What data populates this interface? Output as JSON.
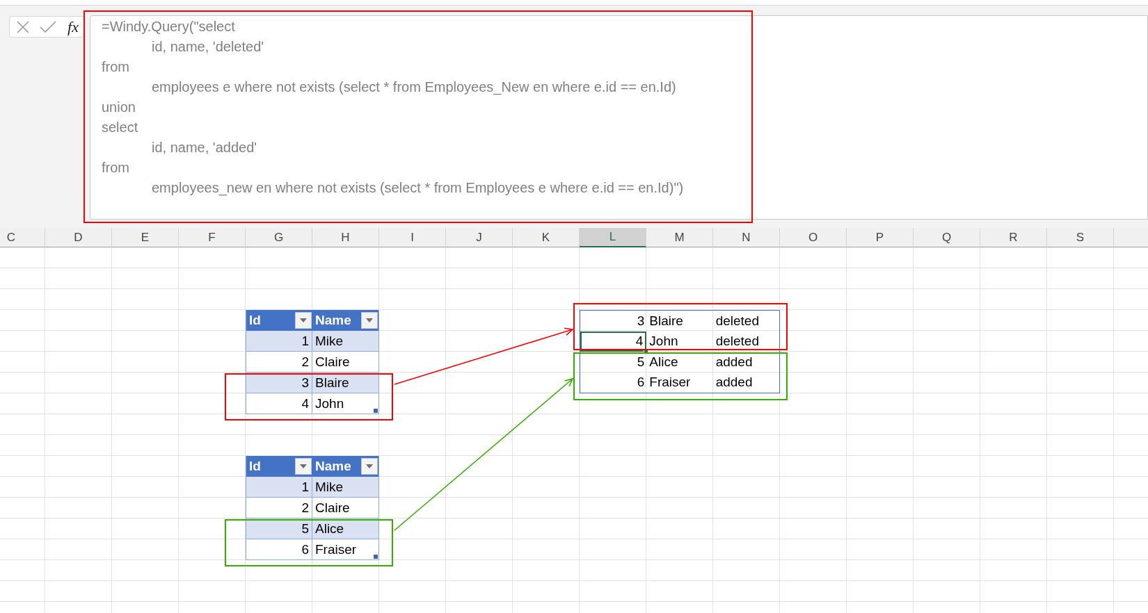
{
  "formula_bar": {
    "function_label": "fx",
    "value": "=Windy.Query(\"select\n\tid, name, 'deleted'\nfrom\n\temployees e where not exists (select * from Employees_New en where e.id == en.Id)\nunion\nselect\n\tid, name, 'added'\nfrom\n\temployees_new en where not exists (select * from Employees e where e.id == en.Id)\")",
    "highlight": {
      "color": "#ff0000"
    }
  },
  "column_headers": [
    {
      "label": "C",
      "selected": false
    },
    {
      "label": "D",
      "selected": false
    },
    {
      "label": "E",
      "selected": false
    },
    {
      "label": "F",
      "selected": false
    },
    {
      "label": "G",
      "selected": false
    },
    {
      "label": "H",
      "selected": false
    },
    {
      "label": "I",
      "selected": false
    },
    {
      "label": "J",
      "selected": false
    },
    {
      "label": "K",
      "selected": false
    },
    {
      "label": "L",
      "selected": true
    },
    {
      "label": "M",
      "selected": false
    },
    {
      "label": "N",
      "selected": false
    },
    {
      "label": "O",
      "selected": false
    },
    {
      "label": "P",
      "selected": false
    },
    {
      "label": "Q",
      "selected": false
    },
    {
      "label": "R",
      "selected": false
    },
    {
      "label": "S",
      "selected": false
    }
  ],
  "tables": [
    {
      "columns": [
        "Id",
        "Name"
      ],
      "highlight": {
        "color": "#ff0000"
      },
      "rows": [
        {
          "cells": [
            "1",
            "Mike"
          ],
          "highlighted": false
        },
        {
          "cells": [
            "2",
            "Claire"
          ],
          "highlighted": false
        },
        {
          "cells": [
            "3",
            "Blaire"
          ],
          "highlighted": true
        },
        {
          "cells": [
            "4",
            "John"
          ],
          "highlighted": true
        }
      ]
    },
    {
      "columns": [
        "Id",
        "Name"
      ],
      "highlight": {
        "color": "#33af00"
      },
      "rows": [
        {
          "cells": [
            "1",
            "Mike"
          ],
          "highlighted": false
        },
        {
          "cells": [
            "2",
            "Claire"
          ],
          "highlighted": false
        },
        {
          "cells": [
            "5",
            "Alice"
          ],
          "highlighted": true
        },
        {
          "cells": [
            "6",
            "Fraiser"
          ],
          "highlighted": true
        }
      ]
    }
  ],
  "query_result": {
    "groups": [
      {
        "color": "#ff0000",
        "rows": [
          {
            "cells": [
              {
                "text": "3",
                "selected": false
              },
              {
                "text": "Blaire",
                "selected": false
              },
              {
                "text": "deleted",
                "selected": false
              }
            ]
          },
          {
            "cells": [
              {
                "text": "4",
                "selected": true
              },
              {
                "text": "John",
                "selected": false
              },
              {
                "text": "deleted",
                "selected": false
              }
            ]
          }
        ]
      },
      {
        "color": "#33af00",
        "rows": [
          {
            "cells": [
              {
                "text": "5",
                "selected": false
              },
              {
                "text": "Alice",
                "selected": false
              },
              {
                "text": "added",
                "selected": false
              }
            ]
          },
          {
            "cells": [
              {
                "text": "6",
                "selected": false
              },
              {
                "text": "Fraiser",
                "selected": false
              },
              {
                "text": "added",
                "selected": false
              }
            ]
          }
        ]
      }
    ]
  }
}
